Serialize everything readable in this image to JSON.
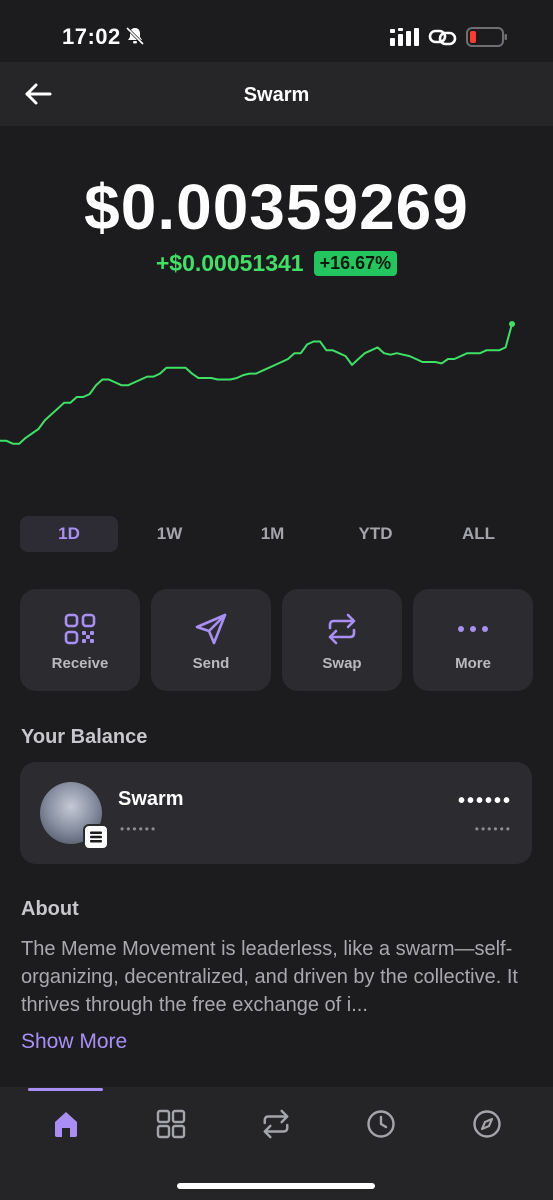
{
  "status_bar": {
    "time": "17:02"
  },
  "header": {
    "title": "Swarm"
  },
  "price": {
    "current": "$0.00359269",
    "change": "+$0.00051341",
    "change_pct": "+16.67%"
  },
  "chart_data": {
    "type": "line",
    "title": "",
    "xlabel": "",
    "ylabel": "",
    "color": "#3ee066",
    "values": [
      0.2,
      0.2,
      0.18,
      0.18,
      0.22,
      0.25,
      0.28,
      0.34,
      0.38,
      0.42,
      0.46,
      0.46,
      0.5,
      0.5,
      0.52,
      0.58,
      0.62,
      0.62,
      0.6,
      0.58,
      0.58,
      0.6,
      0.62,
      0.64,
      0.64,
      0.66,
      0.7,
      0.7,
      0.7,
      0.7,
      0.66,
      0.63,
      0.63,
      0.63,
      0.62,
      0.62,
      0.62,
      0.63,
      0.65,
      0.66,
      0.66,
      0.68,
      0.7,
      0.72,
      0.74,
      0.76,
      0.8,
      0.8,
      0.86,
      0.88,
      0.88,
      0.82,
      0.82,
      0.8,
      0.78,
      0.72,
      0.76,
      0.8,
      0.82,
      0.84,
      0.8,
      0.79,
      0.8,
      0.79,
      0.78,
      0.76,
      0.74,
      0.74,
      0.74,
      0.73,
      0.76,
      0.76,
      0.78,
      0.8,
      0.8,
      0.8,
      0.82,
      0.82,
      0.82,
      0.84,
      1.0
    ]
  },
  "timeframes": [
    {
      "label": "1D",
      "active": true
    },
    {
      "label": "1W",
      "active": false
    },
    {
      "label": "1M",
      "active": false
    },
    {
      "label": "YTD",
      "active": false
    },
    {
      "label": "ALL",
      "active": false
    }
  ],
  "actions": [
    {
      "label": "Receive",
      "icon": "qr-code-icon"
    },
    {
      "label": "Send",
      "icon": "send-icon"
    },
    {
      "label": "Swap",
      "icon": "swap-icon"
    },
    {
      "label": "More",
      "icon": "more-icon"
    }
  ],
  "balance": {
    "section_title": "Your Balance",
    "token_name": "Swarm",
    "token_amount_hidden": "••••••",
    "value_hidden": "••••••",
    "value_sub_hidden": "••••••"
  },
  "about": {
    "section_title": "About",
    "text": "The Meme Movement is leaderless, like a swarm—self-organizing, decentralized, and driven by the collective. It thrives through the free exchange of i...",
    "show_more": "Show More"
  },
  "nav": {
    "items": [
      "home-icon",
      "grid-icon",
      "swap-icon",
      "history-icon",
      "explore-icon"
    ],
    "active": "home-icon",
    "accent": "#a98ff5"
  }
}
